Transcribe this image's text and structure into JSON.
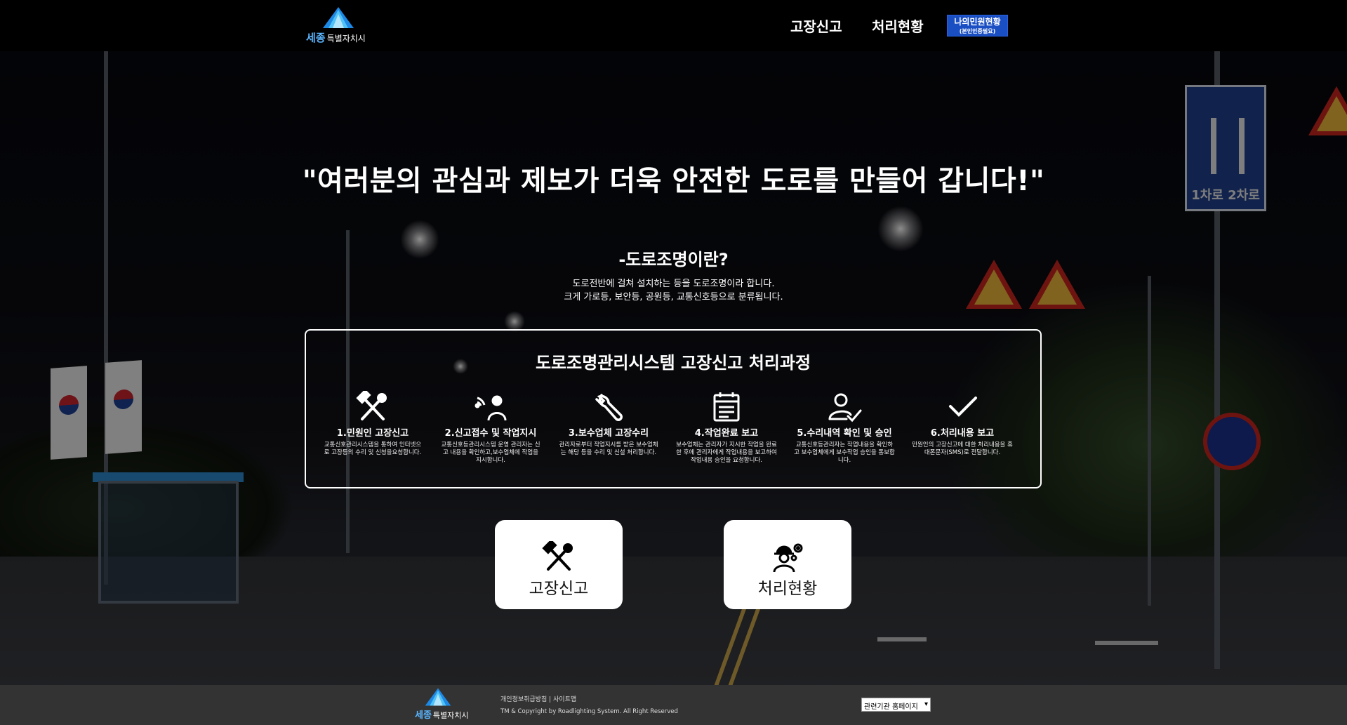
{
  "header": {
    "logo": {
      "text_big": "세종",
      "text_small": "특별자치시"
    },
    "nav": {
      "report": "고장신고",
      "status": "처리현황",
      "my_status": "나의민원현황",
      "my_status_sub": "(본인인증필요)"
    }
  },
  "hero": {
    "headline": "\"여러분의 관심과 제보가 더욱 안전한 도로를 만들어 갑니다!\"",
    "subtitle": "-도로조명이란?",
    "desc_line1": "도로전반에 걸쳐 설치하는 등을 도로조명이라 합니다.",
    "desc_line2": "크게 가로등, 보안등, 공원등, 교통신호등으로 분류됩니다.",
    "road_sign": "1차로 2차로"
  },
  "process": {
    "title": "도로조명관리시스템 고장신고 처리과정",
    "steps": [
      {
        "name": "1.민원인 고장신고",
        "body": "교통신호관리시스템을 통하여 인터넷으로 고장등의 수리 및 신청을요청합니다.",
        "icon": "tools-icon"
      },
      {
        "name": "2.신고접수 및 작업지시",
        "body": "교통신호등관리시스템 운영 관리자는 신고 내용을 확인하고,보수업체에 작업을 지시합니다.",
        "icon": "worker-wifi-icon"
      },
      {
        "name": "3.보수업체 고장수리",
        "body": "관리자로부터 작업지시를 받은 보수업체는 해당 등을 수리 및 신설 처리합니다.",
        "icon": "wrench-icon"
      },
      {
        "name": "4.작업완료 보고",
        "body": "보수업체는 관리자가 지시한 작업을 완료한 후에 관리자에게 작업내용을 보고하여 작업내용 승인을 요청합니다.",
        "icon": "calendar-icon"
      },
      {
        "name": "5.수리내역 확인 및 승인",
        "body": "교통신호등관리자는 작업내용을 확인하고 보수업체에게 보수작업 승인을 통보합니다.",
        "icon": "user-check-icon"
      },
      {
        "name": "6.처리내용 보고",
        "body": "민원인의 고장신고에 대한 처리내용을 휴대폰문자(SMS)로 전달합니다.",
        "icon": "check-icon"
      }
    ]
  },
  "actions": {
    "report_label": "고장신고",
    "status_label": "처리현황"
  },
  "footer": {
    "privacy": "개인정보취급방침",
    "separator": " | ",
    "sitemap": "사이트맵",
    "copyright": "TM & Copyright by Roadlighting System. All Right Reserved",
    "related_select": "관련기관 홈페이지"
  },
  "colors": {
    "header_bg": "#000000",
    "accent_blue": "#1a4fc4",
    "footer_bg": "#333333",
    "logo_blue": "#5bb6ff"
  }
}
